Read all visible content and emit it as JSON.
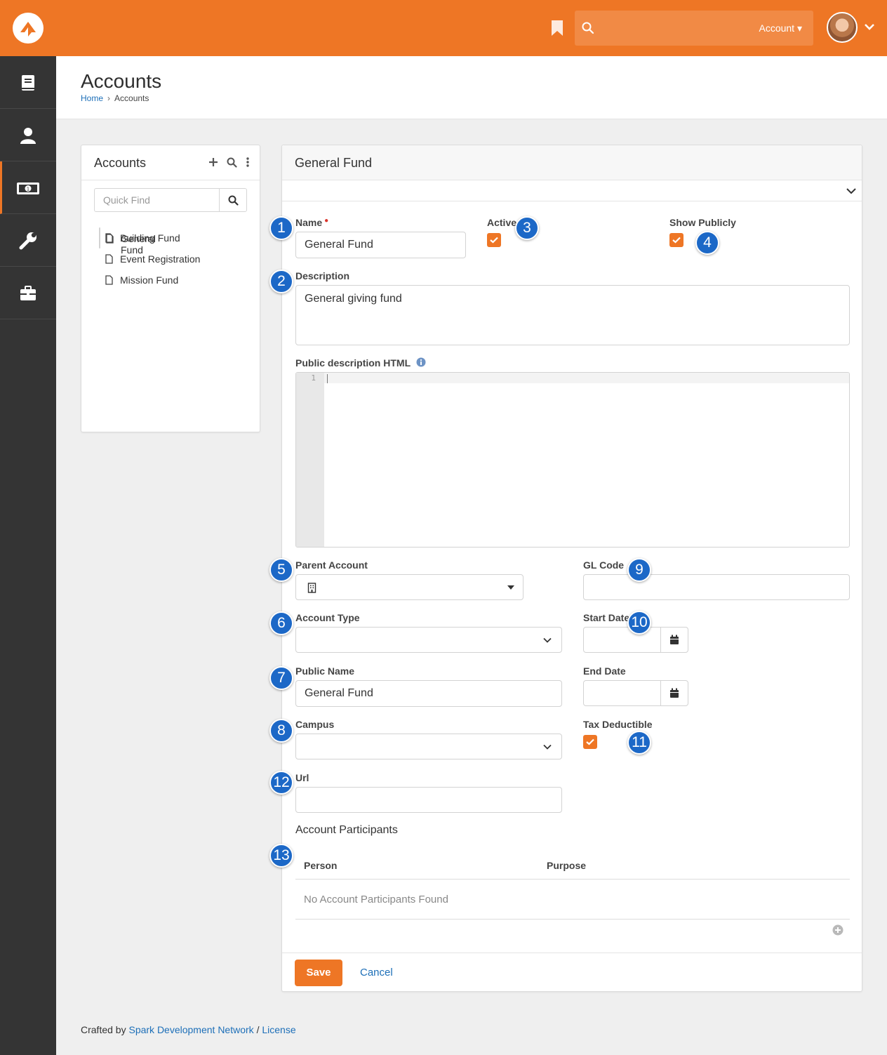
{
  "header": {
    "search_placeholder": "",
    "account_label": "Account ▾"
  },
  "page": {
    "title": "Accounts",
    "breadcrumb": [
      "Home",
      "Accounts"
    ]
  },
  "tree_panel": {
    "title": "Accounts",
    "quickfind_placeholder": "Quick Find",
    "items": [
      {
        "label": "General Fund",
        "selected": true
      },
      {
        "label": "Building Fund"
      },
      {
        "label": "Event Registration"
      },
      {
        "label": "Mission Fund"
      }
    ]
  },
  "detail": {
    "title": "General Fund",
    "fields": {
      "name_label": "Name",
      "name_value": "General Fund",
      "active_label": "Active",
      "active_checked": true,
      "show_publicly_label": "Show Publicly",
      "show_publicly_checked": true,
      "description_label": "Description",
      "description_value": "General giving fund",
      "public_desc_label": "Public description HTML",
      "editor_line": "1",
      "parent_account_label": "Parent Account",
      "gl_code_label": "GL Code",
      "account_type_label": "Account Type",
      "start_date_label": "Start Date",
      "public_name_label": "Public Name",
      "public_name_value": "General Fund",
      "end_date_label": "End Date",
      "campus_label": "Campus",
      "tax_deductible_label": "Tax Deductible",
      "tax_deductible_checked": true,
      "url_label": "Url"
    },
    "participants": {
      "heading": "Account Participants",
      "columns": [
        "Person",
        "Purpose"
      ],
      "empty_text": "No Account Participants Found"
    },
    "actions": {
      "save": "Save",
      "cancel": "Cancel"
    }
  },
  "callouts": [
    "1",
    "2",
    "3",
    "4",
    "5",
    "6",
    "7",
    "8",
    "9",
    "10",
    "11",
    "12",
    "13"
  ],
  "footer": {
    "prefix": "Crafted by",
    "link1": "Spark Development Network",
    "sep": "/",
    "link2": "License"
  },
  "colors": {
    "brand": "#ee7625",
    "sidebar": "#343434",
    "callout": "#1c68c7",
    "link": "#1d6fb8"
  }
}
